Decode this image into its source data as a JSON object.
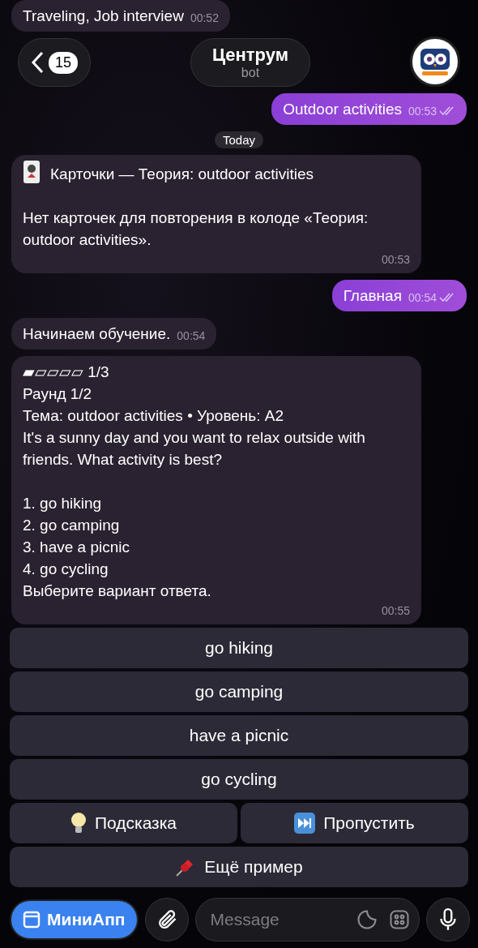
{
  "header": {
    "back_count": "15",
    "title": "Центрум",
    "subtitle": "bot"
  },
  "messages": [
    {
      "kind": "incoming",
      "text": "Traveling, Job interview",
      "time": "00:52"
    },
    {
      "kind": "outgoing",
      "text": "Outdoor activities",
      "time": "00:53",
      "read": true
    },
    {
      "kind": "date",
      "text": "Today"
    },
    {
      "kind": "cards",
      "text": "Карточки — Теория: outdoor activities\n\nНет карточек для повторения в колоде «Теория: outdoor activities».",
      "time": "00:53"
    },
    {
      "kind": "outgoing",
      "text": "Главная",
      "time": "00:54",
      "read": true
    },
    {
      "kind": "incoming",
      "text": "Начинаем обучение.",
      "time": "00:54"
    },
    {
      "kind": "incoming",
      "text": "▰▱▱▱▱ 1/3\nРаунд 1/2\nТема: outdoor activities • Уровень: A2\nIt's a sunny day and you want to relax outside with friends. What activity is best?\n\n1. go hiking\n2. go camping\n3. have a picnic\n4. go cycling\nВыберите вариант ответа.",
      "time": "00:55"
    }
  ],
  "keyboard": [
    [
      {
        "kind": "plain",
        "label": "go hiking"
      }
    ],
    [
      {
        "kind": "plain",
        "label": "go camping"
      }
    ],
    [
      {
        "kind": "plain",
        "label": "have a picnic"
      }
    ],
    [
      {
        "kind": "plain",
        "label": "go cycling"
      }
    ],
    [
      {
        "kind": "hint",
        "label": "Подсказка"
      },
      {
        "kind": "skip",
        "label": "Пропустить"
      }
    ],
    [
      {
        "kind": "example",
        "label": "Ещё пример"
      }
    ]
  ],
  "input": {
    "app_button": "МиниАпп",
    "placeholder": "Message"
  }
}
